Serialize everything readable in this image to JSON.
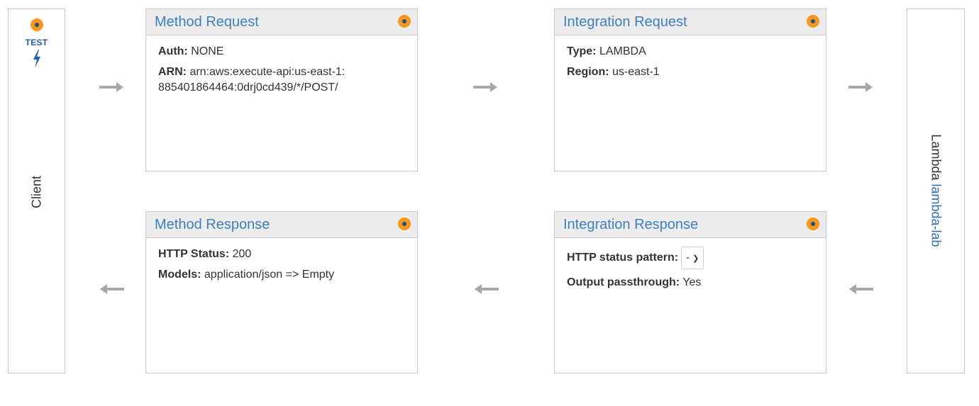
{
  "client": {
    "label": "Client",
    "test_label": "TEST"
  },
  "lambda": {
    "prefix": "Lambda",
    "function_name": "lambda-lab"
  },
  "method_request": {
    "title": "Method Request",
    "auth_label": "Auth:",
    "auth_value": "NONE",
    "arn_label": "ARN:",
    "arn_value": "arn:aws:execute-api:us-east-1:885401864464:0drj0cd439/*/POST/"
  },
  "integration_request": {
    "title": "Integration Request",
    "type_label": "Type:",
    "type_value": "LAMBDA",
    "region_label": "Region:",
    "region_value": "us-east-1"
  },
  "method_response": {
    "title": "Method Response",
    "status_label": "HTTP Status:",
    "status_value": "200",
    "models_label": "Models:",
    "models_value": "application/json => Empty"
  },
  "integration_response": {
    "title": "Integration Response",
    "pattern_label": "HTTP status pattern:",
    "pattern_value": "-",
    "passthrough_label": "Output passthrough:",
    "passthrough_value": "Yes"
  },
  "colors": {
    "accent": "#3f7fc0",
    "status_dot": "#f7981d",
    "arrow": "#a8a8a8"
  }
}
